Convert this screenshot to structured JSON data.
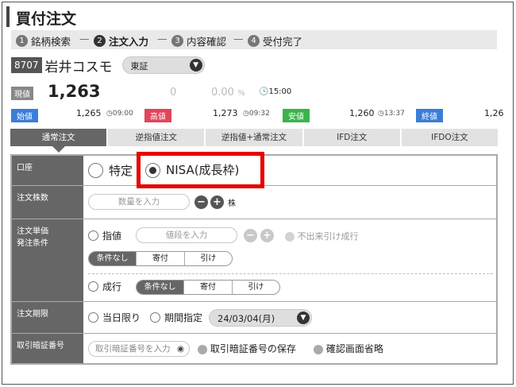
{
  "title": "買付注文",
  "steps": [
    {
      "num": "1",
      "label": "銘柄検索"
    },
    {
      "num": "2",
      "label": "注文入力"
    },
    {
      "num": "3",
      "label": "内容確認"
    },
    {
      "num": "4",
      "label": "受付完了"
    }
  ],
  "stock": {
    "code": "8707",
    "name": "岩井コスモ",
    "market": "東証"
  },
  "price": {
    "label": "現値",
    "value": "1,263",
    "change": "0",
    "pct": "0.00",
    "pct_unit": "%",
    "time": "15:00"
  },
  "ohlc": [
    {
      "label": "始値",
      "value": "1,265",
      "time": "09:00",
      "color": "#3b7dd8"
    },
    {
      "label": "高値",
      "value": "1,273",
      "time": "09:32",
      "color": "#e0455a"
    },
    {
      "label": "安値",
      "value": "1,260",
      "time": "13:37",
      "color": "#3bb34a"
    },
    {
      "label": "終値",
      "value": "1,26",
      "time": "",
      "color": "#3b7dd8"
    }
  ],
  "tabs": [
    "通常注文",
    "逆指値注文",
    "逆指値+通常注文",
    "IFD注文",
    "IFDO注文"
  ],
  "form": {
    "account": {
      "label": "口座",
      "option1": "特定",
      "option2": "NISA(成長枠)"
    },
    "quantity": {
      "label": "注文株数",
      "placeholder": "数量を入力",
      "unit": "株"
    },
    "price_cond": {
      "label1": "注文単価",
      "label2": "発注条件",
      "limit_label": "指値",
      "price_placeholder": "値段を入力",
      "no_trade_label": "不出来引け成行",
      "limit_conditions": [
        "条件なし",
        "寄付",
        "引け"
      ],
      "market_label": "成行",
      "market_conditions": [
        "条件なし",
        "寄付",
        "引け"
      ]
    },
    "period": {
      "label": "注文期限",
      "today": "当日限り",
      "specify": "期間指定",
      "date": "24/03/04(月)"
    },
    "pin": {
      "label": "取引暗証番号",
      "placeholder": "取引暗証番号を入力",
      "save": "取引暗証番号の保存",
      "skip": "確認画面省略"
    }
  }
}
